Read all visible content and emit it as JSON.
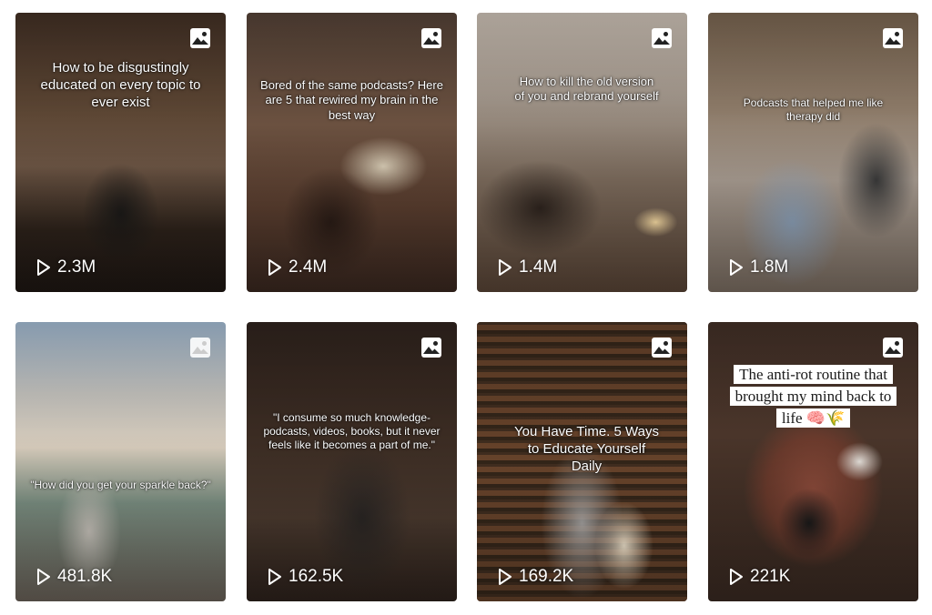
{
  "cards": [
    {
      "caption": "How to be disgustingly educated on every topic to ever exist",
      "views": "2.3M",
      "icon": "photo-icon"
    },
    {
      "caption": "Bored of the same podcasts? Here are 5 that rewired my brain in the best way",
      "views": "2.4M",
      "icon": "photo-icon"
    },
    {
      "caption": "How to kill the old version of you and rebrand yourself",
      "views": "1.4M",
      "icon": "photo-icon"
    },
    {
      "caption": "Podcasts that helped me like therapy did",
      "views": "1.8M",
      "icon": "photo-icon"
    },
    {
      "caption": "\"How did you get your sparkle back?\"",
      "views": "481.8K",
      "icon": "photo-icon"
    },
    {
      "caption": "\"I consume so much knowledge- podcasts, videos, books, but it never feels like it becomes a part of me.\"",
      "views": "162.5K",
      "icon": "photo-icon"
    },
    {
      "caption": "You Have Time. 5 Ways to Educate Yourself Daily",
      "views": "169.2K",
      "icon": "photo-icon"
    },
    {
      "caption": "The anti-rot routine that brought my mind back to life 🧠🌾",
      "views": "221K",
      "icon": "photo-icon"
    }
  ],
  "colors": {
    "text": "#ffffff",
    "background": "#ffffff"
  }
}
